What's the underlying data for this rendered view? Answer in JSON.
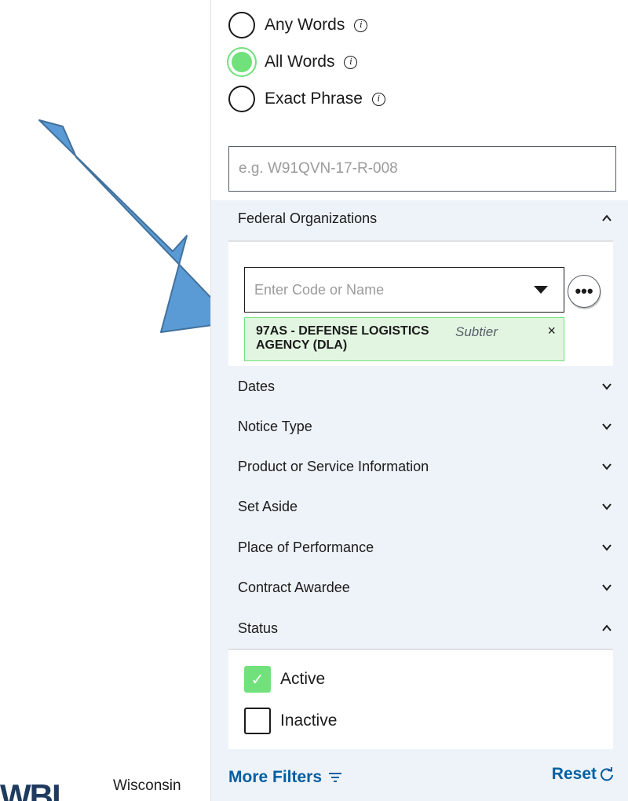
{
  "search_type": {
    "options": [
      {
        "label": "Any Words",
        "checked": false
      },
      {
        "label": "All Words",
        "checked": true
      },
      {
        "label": "Exact Phrase",
        "checked": false
      }
    ]
  },
  "solicitation": {
    "placeholder": "e.g. W91QVN-17-R-008"
  },
  "federal_organizations": {
    "title": "Federal Organizations",
    "expanded": true,
    "combo_placeholder": "Enter Code or Name",
    "more_label": "•••",
    "selected": {
      "name": "97AS - DEFENSE LOGISTICS AGENCY (DLA)",
      "type": "Subtier",
      "remove": "×"
    }
  },
  "accordions": [
    {
      "title": "Dates"
    },
    {
      "title": "Notice Type"
    },
    {
      "title": "Product or Service Information"
    },
    {
      "title": "Set Aside"
    },
    {
      "title": "Place of Performance"
    },
    {
      "title": "Contract Awardee"
    }
  ],
  "status": {
    "title": "Status",
    "expanded": true,
    "options": [
      {
        "label": "Active",
        "checked": true
      },
      {
        "label": "Inactive",
        "checked": false
      }
    ]
  },
  "footer": {
    "more_filters": "More Filters",
    "reset": "Reset"
  },
  "logo": {
    "text": "Wisconsin"
  },
  "colors": {
    "accent": "#70e17b",
    "link": "#005ea2",
    "panel_bg": "#eef3f9",
    "arrow": "#5b9bd5"
  }
}
